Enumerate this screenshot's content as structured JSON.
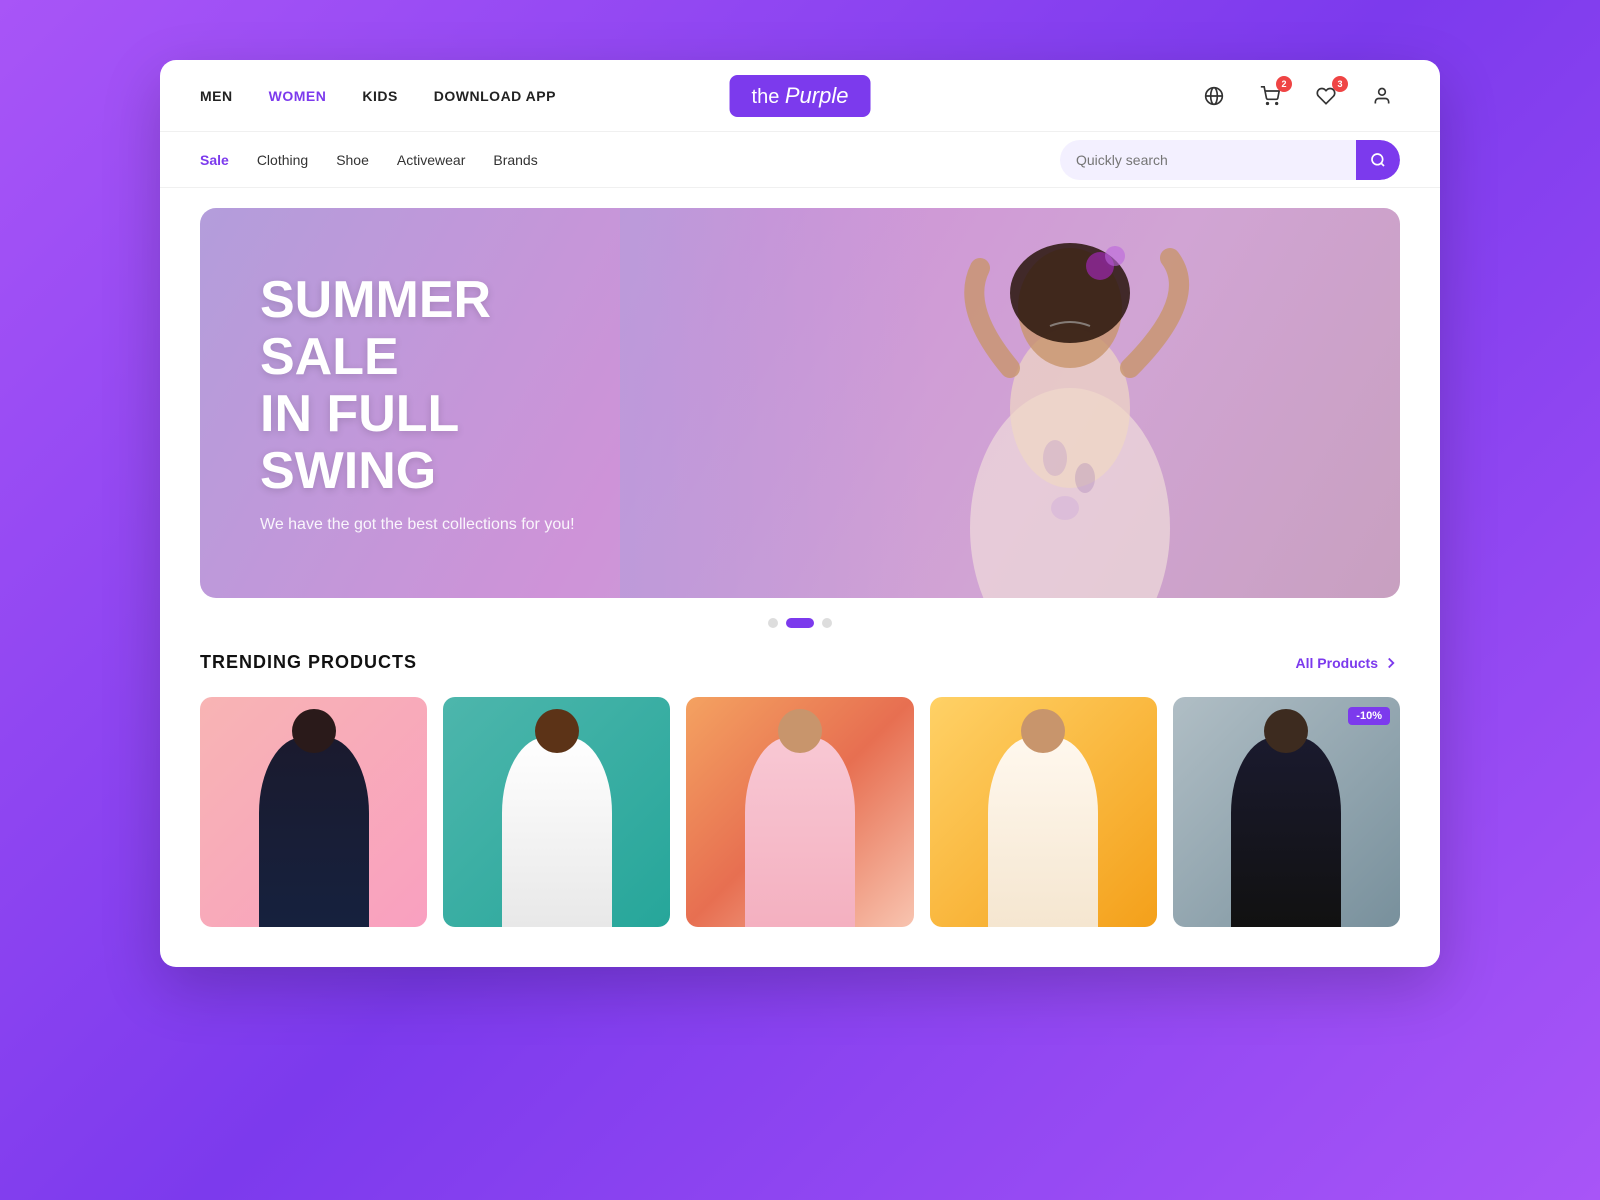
{
  "site": {
    "logo": "the Purple",
    "logo_cursive": "Purple"
  },
  "top_nav": {
    "links": [
      {
        "label": "MEN",
        "active": false
      },
      {
        "label": "WOMEN",
        "active": true
      },
      {
        "label": "KIDS",
        "active": false
      },
      {
        "label": "DOWNLOAD APP",
        "active": false
      }
    ],
    "icons": {
      "globe": "🌐",
      "cart": "🛒",
      "cart_badge": "2",
      "heart": "♡",
      "heart_badge": "3",
      "user": "👤"
    }
  },
  "second_nav": {
    "links": [
      {
        "label": "Sale",
        "active": true
      },
      {
        "label": "Clothing",
        "active": false
      },
      {
        "label": "Shoe",
        "active": false
      },
      {
        "label": "Activewear",
        "active": false
      },
      {
        "label": "Brands",
        "active": false
      }
    ],
    "search_placeholder": "Quickly search"
  },
  "hero": {
    "title_line1": "SUMMER SALE",
    "title_line2": "IN FULL SWING",
    "subtitle": "We have the got the best collections for you!",
    "dots": [
      {
        "active": false
      },
      {
        "active": true
      },
      {
        "active": false
      }
    ]
  },
  "trending": {
    "section_title": "TRENDING PRODUCTS",
    "all_products_label": "All Products",
    "products": [
      {
        "id": 1,
        "color_class": "product-img-pink",
        "person_class": "p1",
        "discount": null
      },
      {
        "id": 2,
        "color_class": "product-img-teal",
        "person_class": "p2",
        "discount": null
      },
      {
        "id": 3,
        "color_class": "product-img-salmon",
        "person_class": "p3",
        "discount": null
      },
      {
        "id": 4,
        "color_class": "product-img-yellow",
        "person_class": "p4",
        "discount": null
      },
      {
        "id": 5,
        "color_class": "product-img-gray",
        "person_class": "p5",
        "discount": "-10%"
      }
    ]
  },
  "colors": {
    "accent": "#7c3aed",
    "accent_light": "#f3f0ff",
    "badge_red": "#ef4444"
  }
}
